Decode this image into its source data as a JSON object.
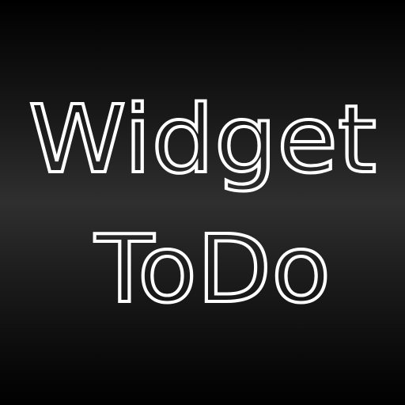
{
  "app_icon": {
    "line1": "Widget",
    "line2": "ToDo",
    "text_color": "#ffffff",
    "background_colors": [
      "#000000",
      "#2f2f2f",
      "#000000"
    ]
  }
}
